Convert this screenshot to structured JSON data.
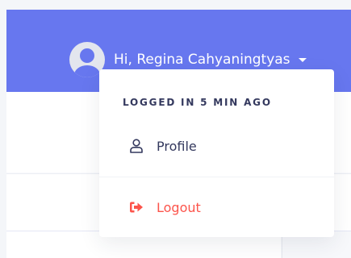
{
  "header": {
    "user_greeting": "Hi, Regina Cahyaningtyas"
  },
  "dropdown": {
    "header_text": "LOGGED IN 5 MIN AGO",
    "items": [
      {
        "label": "Profile",
        "icon": "user-icon"
      },
      {
        "label": "Logout",
        "icon": "logout-icon",
        "color": "#fc544b"
      }
    ]
  },
  "colors": {
    "navbar": "#6777ef",
    "danger": "#fc544b",
    "text": "#34395e"
  }
}
